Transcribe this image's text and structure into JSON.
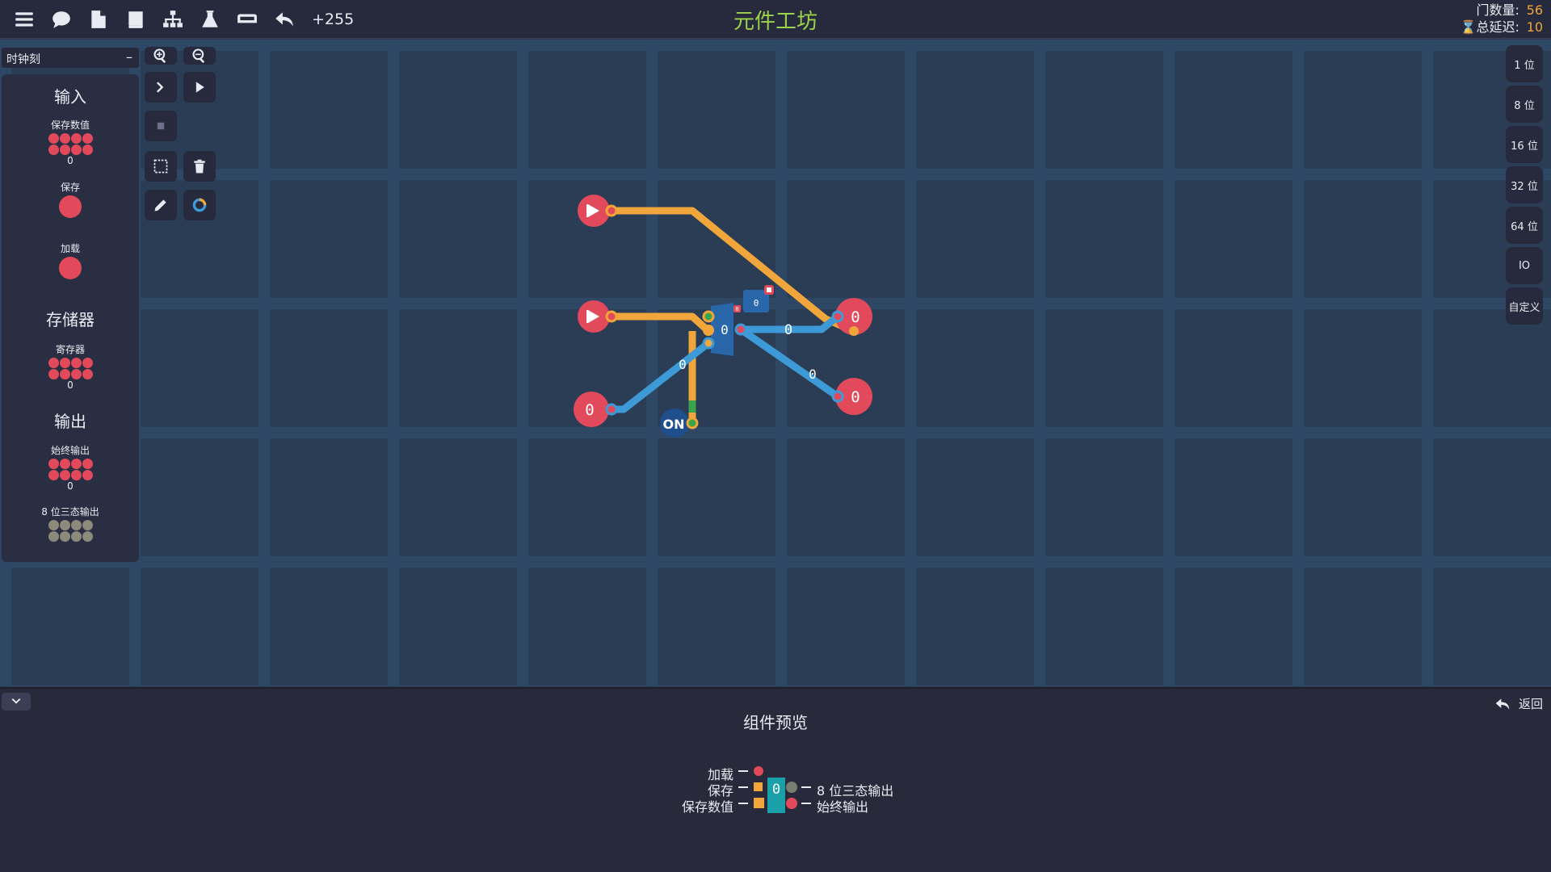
{
  "topbar": {
    "title": "元件工坊",
    "count_label": "+255",
    "gate_count_label": "门数量:",
    "gate_count_value": "56",
    "delay_label": "总延迟:",
    "delay_value": "10",
    "icons": [
      "menu-icon",
      "comment-icon",
      "file-icon",
      "book-icon",
      "hierarchy-icon",
      "flask-icon",
      "chip-icon",
      "undo-icon"
    ]
  },
  "sidebar": {
    "header": "时钟刻",
    "collapse_glyph": "–",
    "sections": {
      "input": "输入",
      "storage": "存储器",
      "output": "输出"
    },
    "items": {
      "save_value": {
        "label": "保存数值",
        "value": "0"
      },
      "save": {
        "label": "保存"
      },
      "load": {
        "label": "加载"
      },
      "register": {
        "label": "寄存器",
        "value": "0"
      },
      "always_output": {
        "label": "始终输出",
        "value": "0"
      },
      "tristate_output": {
        "label": "8 位三态输出"
      }
    }
  },
  "right_buttons": [
    "1 位",
    "8 位",
    "16 位",
    "32 位",
    "64 位",
    "IO",
    "自定义"
  ],
  "circuit": {
    "switch_label": "ON",
    "register_value": "0",
    "register_small_badge": "8",
    "input_value": "0",
    "out1_value": "0",
    "out2_value": "0",
    "wire_value_1": "0",
    "wire_value_2": "0",
    "wire_value_3": "0",
    "wire_value_4": "0",
    "chip_value": "0"
  },
  "preview": {
    "title": "组件预览",
    "back_label": "返回",
    "pin_load": "加载",
    "pin_save": "保存",
    "pin_save_value": "保存数值",
    "pin_tristate": "8 位三态输出",
    "pin_always": "始终输出",
    "chip_value": "0"
  },
  "colors": {
    "accent_title": "#9bd34a",
    "stat_value": "#f0a63a",
    "pin_red": "#e24a5c",
    "wire_orange": "#f0a63a",
    "wire_blue": "#3d9ad6",
    "board": "#2e4765"
  }
}
